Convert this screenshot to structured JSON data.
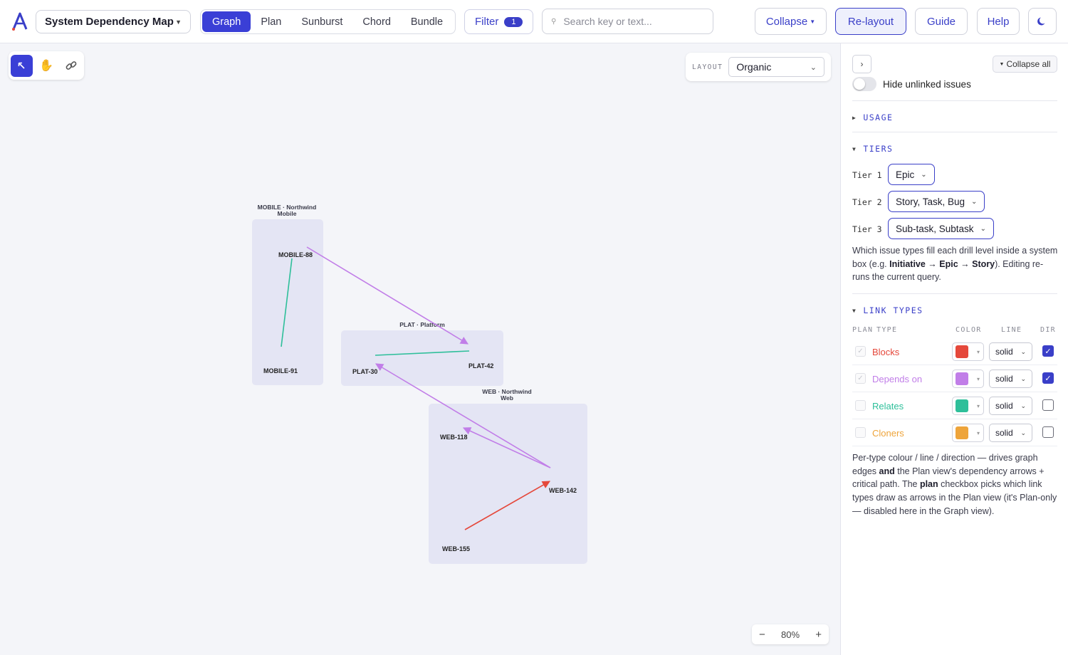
{
  "app": {
    "logo": "logo-a-icon"
  },
  "header": {
    "map_name": "System Dependency Map",
    "view_tabs": [
      "Graph",
      "Plan",
      "Sunburst",
      "Chord",
      "Bundle"
    ],
    "active_tab": "Graph",
    "filter_label": "Filter",
    "filter_count": "1",
    "search_placeholder": "Search key or text...",
    "collapse_label": "Collapse",
    "relayout_label": "Re-layout",
    "guide_label": "Guide",
    "help_label": "Help",
    "theme_icon": "moon-icon"
  },
  "canvas": {
    "tools": [
      "pointer-icon",
      "hand-icon",
      "link-icon"
    ],
    "layout_label": "LAYOUT",
    "layout_value": "Organic",
    "zoom_out": "−",
    "zoom_level": "80%",
    "zoom_in": "+",
    "systems": [
      {
        "title_line1": "MOBILE · Northwind",
        "title_line2": "Mobile"
      },
      {
        "title_line1": "PLAT · Platform",
        "title_line2": ""
      },
      {
        "title_line1": "WEB · Northwind",
        "title_line2": "Web"
      }
    ],
    "nodes": [
      "MOBILE-88",
      "MOBILE-91",
      "PLAT-30",
      "PLAT-42",
      "WEB-118",
      "WEB-142",
      "WEB-155"
    ]
  },
  "panel": {
    "expand_icon": "chevron-right-icon",
    "collapse_all": "Collapse all",
    "hide_unlinked": "Hide unlinked issues",
    "hide_unlinked_on": false,
    "usage_title": "USAGE",
    "tiers_title": "TIERS",
    "tiers": [
      {
        "label": "Tier 1",
        "value": "Epic"
      },
      {
        "label": "Tier 2",
        "value": "Story, Task, Bug"
      },
      {
        "label": "Tier 3",
        "value": "Sub-task, Subtask"
      }
    ],
    "tiers_help": {
      "p1": "Which issue types fill each drill level inside a system box (e.g. ",
      "b1": "Initiative → Epic → Story",
      "p2": "). Editing re-runs the current query."
    },
    "link_types_title": "LINK TYPES",
    "columns": {
      "plan": "PLAN",
      "type": "TYPE",
      "color": "COLOR",
      "line": "LINE",
      "dir": "DIR"
    },
    "link_types": [
      {
        "name": "Blocks",
        "color": "#e5483b",
        "line": "solid",
        "plan": true,
        "dir": true
      },
      {
        "name": "Depends on",
        "color": "#c17ee8",
        "line": "solid",
        "plan": true,
        "dir": true
      },
      {
        "name": "Relates",
        "color": "#2ebf9a",
        "line": "solid",
        "plan": false,
        "dir": false
      },
      {
        "name": "Cloners",
        "color": "#eea43a",
        "line": "solid",
        "plan": false,
        "dir": false
      }
    ],
    "link_help": {
      "p1": "Per-type colour / line / direction — drives graph edges ",
      "b1": "and",
      "p2": " the Plan view's dependency arrows + critical path. The ",
      "b2": "plan",
      "p3": " checkbox picks which link types draw as arrows in the Plan view (it's Plan-only — disabled here in the Graph view)."
    }
  }
}
